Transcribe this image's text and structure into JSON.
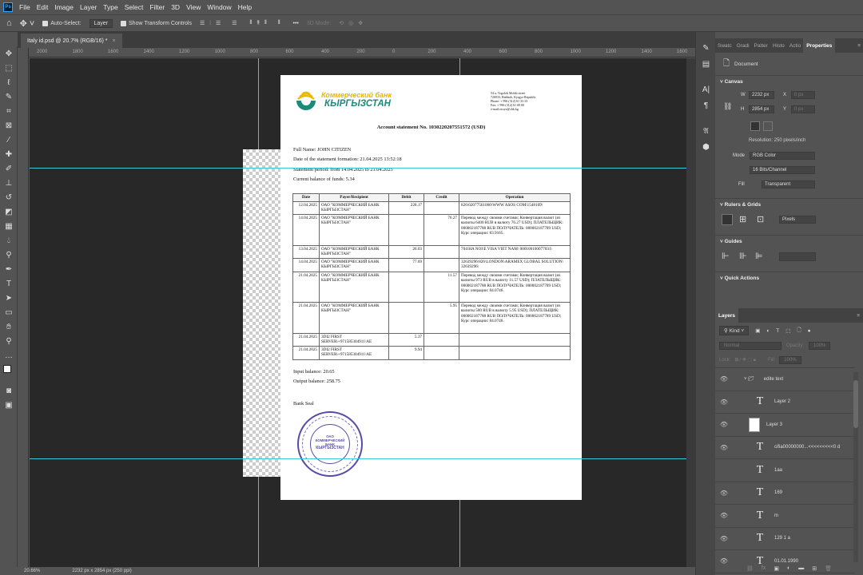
{
  "app": {
    "logo": "Ps"
  },
  "menu": [
    "File",
    "Edit",
    "Image",
    "Layer",
    "Type",
    "Select",
    "Filter",
    "3D",
    "View",
    "Window",
    "Help"
  ],
  "options": {
    "auto_select_label": "Auto-Select:",
    "auto_select_value": "Layer",
    "show_transform_label": "Show Transform Controls",
    "more": "•••",
    "mode_3d": "3D Mode:"
  },
  "document_tab": {
    "title": "Italy id.psd @ 20.7% (RGB/16) *",
    "close": "×"
  },
  "ruler_labels": [
    "2000",
    "1800",
    "1600",
    "1400",
    "1200",
    "1000",
    "800",
    "600",
    "400",
    "200",
    "0",
    "200",
    "400",
    "600",
    "800",
    "1000",
    "1200",
    "1400",
    "1600"
  ],
  "status": {
    "zoom": "20.66%",
    "doc_info": "2232 px x 2854 px (250 ppi)"
  },
  "statement": {
    "bank_name_top": "Коммерческий банк",
    "bank_name_bottom": "КЫРГЫЗСТАН",
    "address": [
      "54 a, Togolok Moldo street",
      "720033, Bishkek, Kyrgyz Republic",
      "Phone: + 996 (312) 61 33 33",
      "Fax: + 996 (312) 61 00 00",
      "e-mail:otoyv@cbk.kg"
    ],
    "title": "Account statement No. 1030220207551572  (USD)",
    "info": [
      "Full Name: JOHN CITIZEN",
      "Date of the statement formation: 21.04.2025 13:52:18",
      "Statement period: from 14.04.2025 to 21.04.2025",
      "Current balance of funds: 5.34"
    ],
    "columns": [
      "Date",
      "Payer/Recipient",
      "Debit",
      "Credit",
      "Operation"
    ],
    "rows": [
      [
        "12.04.2025",
        "ОАО \"КОММЕРЧЕСКИЙ БАНК КЫРГЫЗСТАН\"",
        "228.17",
        "",
        "826\\02077561060\\WWW ASOS COM\\1548109\\"
      ],
      [
        "14.04.2025",
        "ОАО \"КОММЕРЧЕСКИЙ БАНК КЫРГЫЗСТАН\"",
        "",
        "76.27",
        "Перевод между своими счетами; Конвертация валют (из валюты 6400 RUB в валюту 76.27 USD); ПЛАТЕЛЬЩИК: 000002187788 RUB ПОЛУЧАТЕЛЬ: 000002187789 USD; Курс операции: 83.9165."
      ],
      [
        "13.04.2025",
        "ОАО \"КОММЕРЧЕСКИЙ БАНК КЫРГЫЗСТАН\"",
        "26.03",
        "",
        "704\\HA NOI\\E VISA VIET NAM\\ 000100100077031\\"
      ],
      [
        "14.04.2025",
        "ОАО \"КОММЕРЧЕСКИЙ БАНК КЫРГЫЗСТАН\"",
        "77.69",
        "",
        "32639296\\826\\LONDON\\ARAMEX GLOBAL SOLUTION\\ 32639296\\"
      ],
      [
        "21.04.2025",
        "ОАО \"КОММЕРЧЕСКИЙ БАНК КЫРГЫЗСТАН\"",
        "",
        "11.57",
        "Перевод между своими счетами; Конвертация валют (из валюты 973 RUB в валюту 11.57 USD); ПЛАТЕЛЬЩИК: 000002187788 RUB ПОЛУЧАТЕЛЬ: 000002187789 USD; Курс операции: 84.0746."
      ],
      [
        "21.04.2025",
        "ОАО \"КОММЕРЧЕСКИЙ БАНК КЫРГЫЗСТАН\"",
        "",
        "5.95",
        "Перевод между своими счетами; Конвертация валют (из валюты 500 RUB в валюту 5.95 USD); ПЛАТЕЛЬЩИК: 000002187788 RUB ПОЛУЧАТЕЛЬ: 000002187789 USD; Курс операции: 84.0746."
      ],
      [
        "21.04.2025",
        "3DI2 FIRST SERVER\\+971585304911\\AE",
        "5.37",
        "",
        ""
      ],
      [
        "21.04.2025",
        "3DI2 FIRST SERVER\\+971585304911\\AE",
        "9.94",
        "",
        ""
      ]
    ],
    "input_balance": "Input balance: 20.65",
    "output_balance": "Output balance: 258.75",
    "seal_label": "Bank Seal",
    "seal_text": [
      "ОАО",
      "КОММЕРЧЕСКИЙ",
      "БАНК",
      "КЫРГЫЗСТАН"
    ]
  },
  "properties": {
    "tabs": [
      "Swatc",
      "Gradi",
      "Patter",
      "Histo",
      "Actio",
      "Properties"
    ],
    "active_tab": "Properties",
    "doc_label": "Document",
    "canvas_section": "Canvas",
    "w_label": "W",
    "w_value": "2232 px",
    "h_label": "H",
    "h_value": "2854 px",
    "x_label": "X",
    "y_label": "Y",
    "x_value": "0 px",
    "y_value": "0 px",
    "resolution": "Resolution: 250 pixels/inch",
    "mode_label": "Mode",
    "mode_value": "RGB Color",
    "depth_value": "16 Bits/Channel",
    "fill_label": "Fill",
    "fill_value": "Transparent",
    "rulers_section": "Rulers & Grids",
    "units_value": "Pixels",
    "guides_section": "Guides",
    "quick_actions": "Quick Actions"
  },
  "layers": {
    "tab": "Layers",
    "kind": "Kind",
    "blend": "Normal",
    "opacity_label": "Opacity:",
    "opacity": "100%",
    "lock_label": "Lock:",
    "fill_label": "Fill:",
    "fill": "100%",
    "items": [
      {
        "name": "edite text",
        "type": "group",
        "visible": true
      },
      {
        "name": "Layer 2",
        "type": "text",
        "visible": true
      },
      {
        "name": "Layer 3",
        "type": "pixel",
        "visible": true
      },
      {
        "name": "cifia00000000...<<<<<<<<<0 d",
        "type": "text",
        "visible": true
      },
      {
        "name": "1aa",
        "type": "text",
        "visible": false
      },
      {
        "name": "169",
        "type": "text",
        "visible": true
      },
      {
        "name": "m",
        "type": "text",
        "visible": true
      },
      {
        "name": "129 1 a",
        "type": "text",
        "visible": true
      },
      {
        "name": "01.01.1990",
        "type": "text",
        "visible": true
      }
    ]
  },
  "colors": {
    "guide": "#3fc7d6",
    "seal": "#5b4aa8",
    "logo_green": "#1a8a7a",
    "logo_yellow": "#e6b800"
  }
}
